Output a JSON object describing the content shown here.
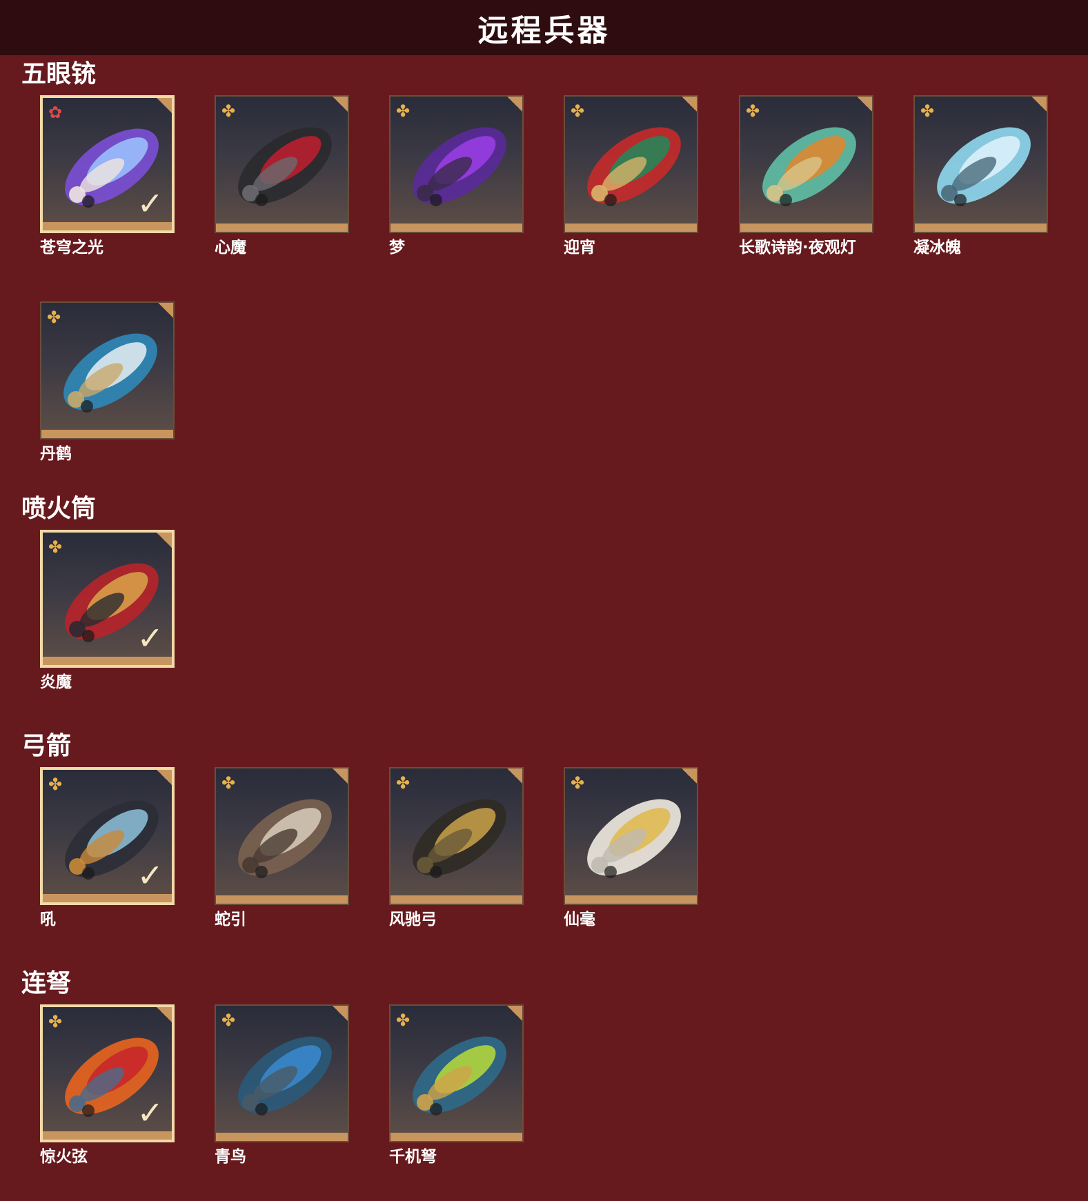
{
  "header": {
    "title": "远程兵器"
  },
  "sections": [
    {
      "title": "五眼铳",
      "items": [
        {
          "name": "苍穹之光",
          "selected": true,
          "rarity": "red-star-icon",
          "colors": [
            "#7b4fd6",
            "#9ec6ff",
            "#efe6e0"
          ]
        },
        {
          "name": "心魔",
          "selected": false,
          "rarity": "gold-star-icon",
          "colors": [
            "#2a2a2e",
            "#c21e2e",
            "#6a6a70"
          ]
        },
        {
          "name": "梦",
          "selected": false,
          "rarity": "gold-star-icon",
          "colors": [
            "#5a2a9a",
            "#9a3ee6",
            "#3a2a4a"
          ]
        },
        {
          "name": "迎宵",
          "selected": false,
          "rarity": "gold-star-icon",
          "colors": [
            "#c62a2a",
            "#1f8a5a",
            "#d9b46a"
          ]
        },
        {
          "name": "长歌诗韵·夜观灯",
          "selected": false,
          "rarity": "gold-star-icon",
          "colors": [
            "#5fbfa5",
            "#e3862b",
            "#d8c48a"
          ]
        },
        {
          "name": "凝冰魄",
          "selected": false,
          "rarity": "gold-star-icon",
          "colors": [
            "#8fd8f0",
            "#dff3fb",
            "#4a6a7a"
          ]
        },
        {
          "name": "丹鹤",
          "selected": false,
          "rarity": "gold-star-icon",
          "colors": [
            "#2f88b8",
            "#e8eef2",
            "#c9a86a"
          ]
        }
      ]
    },
    {
      "title": "喷火筒",
      "items": [
        {
          "name": "炎魔",
          "selected": true,
          "rarity": "gold-star-icon",
          "colors": [
            "#b8232a",
            "#d9a44a",
            "#2a2a30"
          ]
        }
      ]
    },
    {
      "title": "弓箭",
      "items": [
        {
          "name": "吼",
          "selected": true,
          "rarity": "gold-star-icon",
          "colors": [
            "#2b2e36",
            "#8ec2dc",
            "#c98a3a"
          ]
        },
        {
          "name": "蛇引",
          "selected": false,
          "rarity": "gold-star-icon",
          "colors": [
            "#7a6250",
            "#d8cdbb",
            "#4a3a32"
          ]
        },
        {
          "name": "风驰弓",
          "selected": false,
          "rarity": "gold-star-icon",
          "colors": [
            "#2f2a24",
            "#c9a24a",
            "#6a5a3a"
          ]
        },
        {
          "name": "仙毫",
          "selected": false,
          "rarity": "gold-star-icon",
          "colors": [
            "#efeae0",
            "#e0b84a",
            "#bfbab0"
          ]
        }
      ]
    },
    {
      "title": "连弩",
      "items": [
        {
          "name": "惊火弦",
          "selected": true,
          "rarity": "gold-star-icon",
          "colors": [
            "#e8641e",
            "#c8242a",
            "#4a6a8a"
          ]
        },
        {
          "name": "青鸟",
          "selected": false,
          "rarity": "gold-star-icon",
          "colors": [
            "#2a5a7a",
            "#3a8ad0",
            "#4a5a66"
          ]
        },
        {
          "name": "千机弩",
          "selected": false,
          "rarity": "gold-star-icon",
          "colors": [
            "#2f6a8a",
            "#b8dc3a",
            "#cfa24a"
          ]
        }
      ]
    }
  ]
}
